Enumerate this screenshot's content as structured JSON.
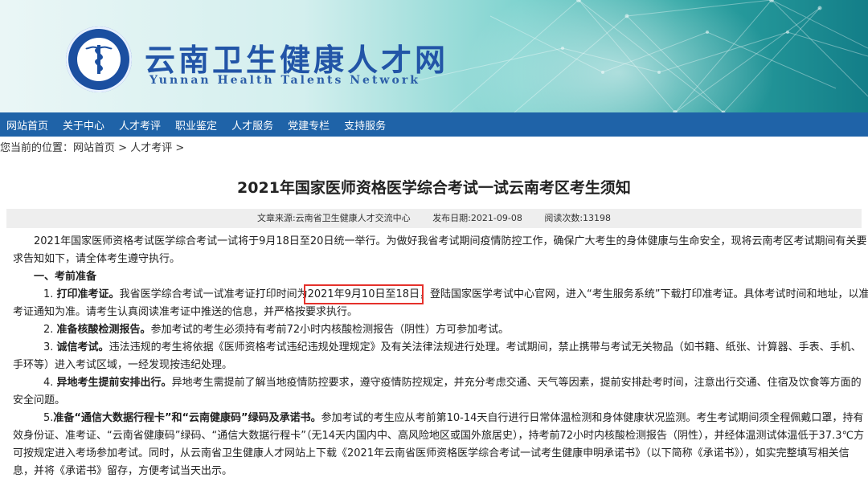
{
  "header": {
    "site_name": "云南卫生健康人才网",
    "site_name_en": "Yunnan Health Talents Network",
    "logo_icon": "caduceus-emblem-icon"
  },
  "nav": {
    "items": [
      "网站首页",
      "关于中心",
      "人才考评",
      "职业鉴定",
      "人才服务",
      "党建专栏",
      "支持服务"
    ]
  },
  "breadcrumb": {
    "prefix": "您当前的位置：",
    "home": "网站首页",
    "sep1": " > ",
    "section": "人才考评",
    "sep2": " >"
  },
  "article": {
    "title": "2021年国家医师资格医学综合考试一试云南考区考生须知",
    "source": "文章来源:云南省卫生健康人才交流中心",
    "date": "发布日期:2021-09-08",
    "views": "阅读次数:13198",
    "intro": "2021年国家医师资格考试医学综合考试一试将于9月18日至20日统一举行。为做好我省考试期间疫情防控工作，确保广大考生的身体健康与生命安全，现将云南考区考试期间有关要求告知如下，请全体考生遵守执行。",
    "section1": "一、考前准备",
    "items": [
      {
        "num": "1.",
        "head": "打印准考证。",
        "pre": "我省医学综合考试一试准考证打印时间为",
        "highlight": "2021年9月10日至18日",
        "post": "，登陆国家医学考试中心官网，进入“考生服务系统”下载打印准考证。具体考试时间和地址，以准考证通知为准。请考生认真阅读准考证中推送的信息，并严格按要求执行。"
      },
      {
        "num": "2.",
        "head": "准备核酸检测报告。",
        "text": "参加考试的考生必须持有考前72小时内核酸检测报告（阴性）方可参加考试。"
      },
      {
        "num": "3.",
        "head": "诚信考试。",
        "text": "违法违规的考生将依据《医师资格考试违纪违规处理规定》及有关法律法规进行处理。考试期间，禁止携带与考试无关物品（如书籍、纸张、计算器、手表、手机、手环等）进入考试区域，一经发现按违纪处理。"
      },
      {
        "num": "4.",
        "head": "异地考生提前安排出行。",
        "text": "异地考生需提前了解当地疫情防控要求，遵守疫情防控规定，并充分考虑交通、天气等因素，提前安排赴考时间，注意出行交通、住宿及饮食等方面的安全问题。"
      },
      {
        "num": "5.",
        "head": "准备“通信大数据行程卡”和“云南健康码”绿码及承诺书。",
        "text": "参加考试的考生应从考前第10-14天自行进行日常体温检测和身体健康状况监测。考生考试期间须全程佩戴口罩，持有效身份证、准考证、“云南省健康码”绿码、“通信大数据行程卡”（无14天内国内中、高风险地区或国外旅居史），持考前72小时内核酸检测报告（阴性），并经体温测试体温低于37.3℃方可按规定进入考场参加考试。同时，从云南省卫生健康人才网站上下载《2021年云南省医师资格医学综合考试一试考生健康申明承诺书》（以下简称《承诺书》），如实完整填写相关信息，并将《承诺书》留存，方便考试当天出示。"
      }
    ]
  },
  "colors": {
    "nav_bg": "#1f63a8",
    "site_name": "#2255a7",
    "highlight_box": "#e5312b",
    "meta_bg": "#eeeeee"
  }
}
